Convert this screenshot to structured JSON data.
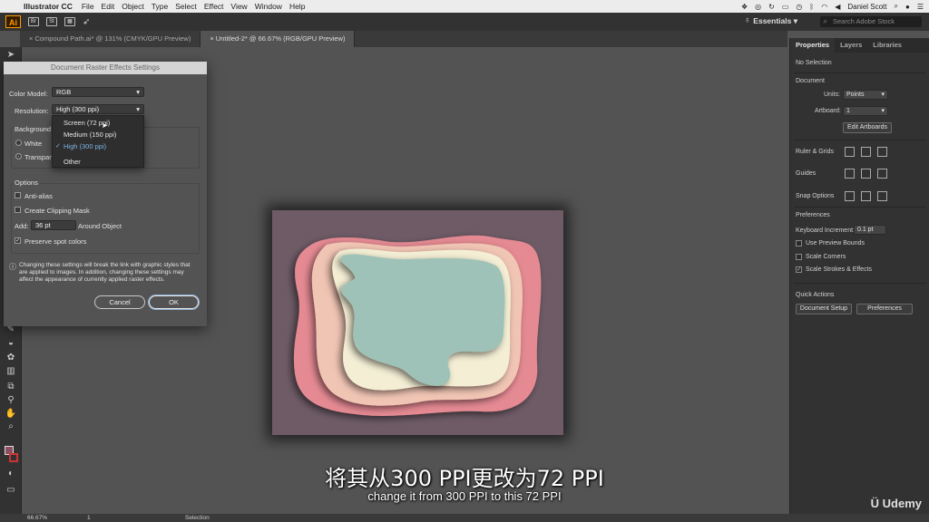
{
  "menubar": {
    "app_name": "Illustrator CC",
    "items": [
      "File",
      "Edit",
      "Object",
      "Type",
      "Select",
      "Effect",
      "View",
      "Window",
      "Help"
    ],
    "user": "Daniel Scott"
  },
  "appbar": {
    "logo": "Ai",
    "workspace": "Essentials",
    "search_placeholder": "Search Adobe Stock"
  },
  "tabs": [
    {
      "label": "Compound Path.ai* @ 131% (CMYK/GPU Preview)"
    },
    {
      "label": "Untitled-2* @ 66.67% (RGB/GPU Preview)"
    }
  ],
  "dialog": {
    "title": "Document Raster Effects Settings",
    "color_model_label": "Color Model:",
    "color_model_value": "RGB",
    "resolution_label": "Resolution:",
    "resolution_value": "High (300 ppi)",
    "background_label": "Background",
    "white_label": "White",
    "transparent_label": "Transpar",
    "options_label": "Options",
    "anti_alias_label": "Anti-alias",
    "clipping_mask_label": "Create Clipping Mask",
    "add_label": "Add:",
    "add_value": "36 pt",
    "around_label": "Around Object",
    "preserve_label": "Preserve spot colors",
    "info_line1": "Changing these settings will break the link with graphic styles that",
    "info_line2": "are applied to images. In addition, changing these settings may",
    "info_line3": "affect the appearance of currently applied raster effects.",
    "cancel_label": "Cancel",
    "ok_label": "OK"
  },
  "resolution_menu": {
    "options": [
      "Screen (72 ppi)",
      "Medium (150 ppi)",
      "High (300 ppi)",
      "Other"
    ],
    "selected": "High (300 ppi)"
  },
  "panel": {
    "tabs": [
      "Properties",
      "Layers",
      "Libraries"
    ],
    "no_selection": "No Selection",
    "document_label": "Document",
    "units_label": "Units:",
    "units_value": "Points",
    "artboard_label": "Artboard:",
    "artboard_value": "1",
    "edit_artboards_label": "Edit Artboards",
    "ruler_grids_label": "Ruler & Grids",
    "guides_label": "Guides",
    "snap_options_label": "Snap Options",
    "preferences_label": "Preferences",
    "keyboard_increment_label": "Keyboard Increment:",
    "keyboard_increment_value": "0.1 pt",
    "use_preview_bounds_label": "Use Preview Bounds",
    "scale_corners_label": "Scale Corners",
    "scale_strokes_label": "Scale Strokes & Effects",
    "quick_actions_label": "Quick Actions",
    "document_setup_label": "Document Setup",
    "preferences_button_label": "Preferences"
  },
  "statusbar": {
    "zoom": "66.67%",
    "artboard": "1",
    "tool": "Selection"
  },
  "subtitles": {
    "zh": "将其从300 PPI更改为72 PPI",
    "en": "change it from 300 PPI to this 72 PPI"
  },
  "watermark": "Udemy",
  "colors": {
    "artboard_bg": "#6e5b66",
    "layer_pink": "#e58a93",
    "layer_peach": "#f1c5b4",
    "layer_cream": "#f3eed4",
    "layer_teal": "#9ec2b7"
  }
}
